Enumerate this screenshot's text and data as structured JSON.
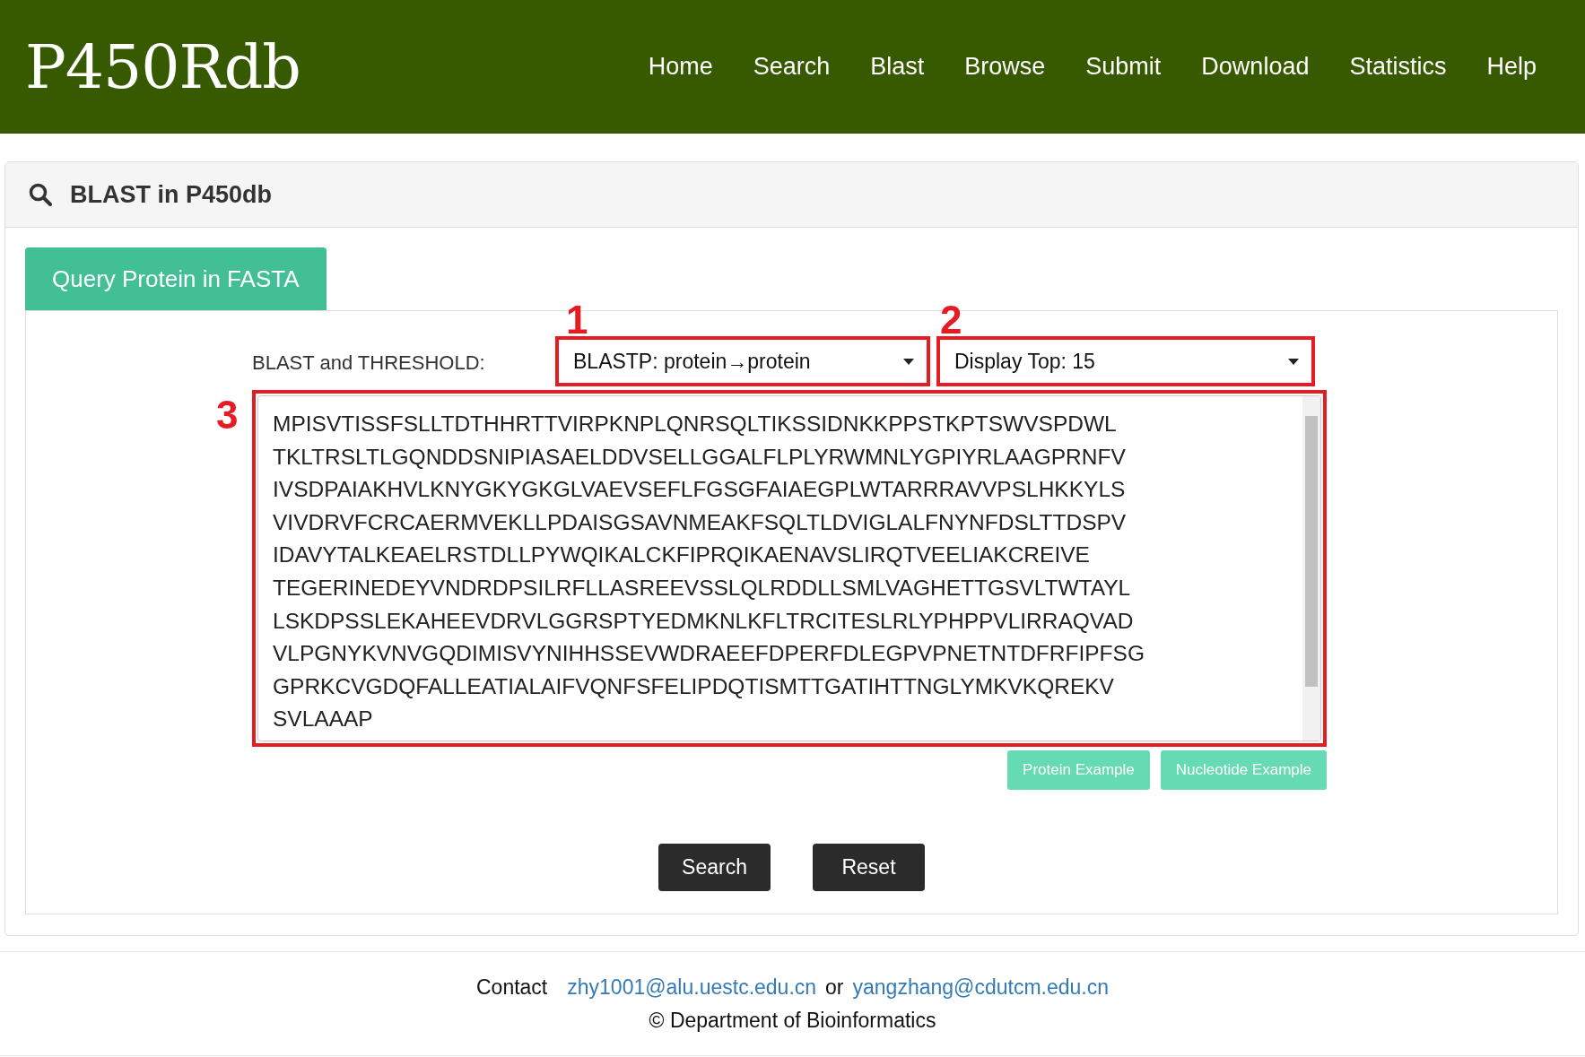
{
  "header": {
    "logo": "P450Rdb",
    "nav": [
      {
        "label": "Home"
      },
      {
        "label": "Search"
      },
      {
        "label": "Blast"
      },
      {
        "label": "Browse"
      },
      {
        "label": "Submit"
      },
      {
        "label": "Download"
      },
      {
        "label": "Statistics"
      },
      {
        "label": "Help"
      }
    ]
  },
  "panel": {
    "title": "BLAST in P450db",
    "tabs": [
      {
        "label": "Query Protein in FASTA",
        "selected": true
      }
    ],
    "form": {
      "label": "BLAST and THRESHOLD:",
      "program_select": {
        "value": "BLASTP:  protein→protein",
        "annotation": "1"
      },
      "display_select": {
        "value": "Display Top:  15",
        "annotation": "2"
      },
      "sequence": {
        "annotation": "3",
        "value": "MPISVTISSFSLLTDTHHRTTVIRPKNPLQNRSQLTIKSSIDNKKPPSTKPTSWVSPDWL\nTKLTRSLTLGQNDDSNIPIASAELDDVSELLGGALFLPLYRWMNLYGPIYRLAAGPRNFV\nIVSDPAIAKHVLKNYGKYGKGLVAEVSEFLFGSGFAIAEGPLWTARRRAVVPSLHKKYLS\nVIVDRVFCRCAERMVEKLLPDAISGSAVNMEAKFSQLTLDVIGLALFNYNFDSLTTDSPV\nIDAVYTALKEAELRSTDLLPYWQIKALCKFIPRQIKAENAVSLIRQTVEELIAKCREIVE\nTEGERINEDEYVNDRDPSILRFLLASREEVSSLQLRDDLLSMLVAGHETTGSVLTWTAYL\nLSKDPSSLEKAHEEVDRVLGGRSPTYEDMKNLKFLTRCITESLRLYPHPPVLIRRAQVAD\nVLPGNYKVNVGQDIMISVYNIHHSSEVWDRAEEFDPERFDLEGPVPNETNTDFRFIPFSG\nGPRKCVGDQFALLEATIALAIFVQNFSFELIPDQTISMTTGATIHTTNGLYMKVKQREKV\nSVLAAAP"
      },
      "example_buttons": [
        "Protein Example",
        "Nucleotide Example"
      ],
      "actions": [
        "Search",
        "Reset"
      ]
    }
  },
  "footer": {
    "contact_label": "Contact",
    "emails": [
      "zhy1001@alu.uestc.edu.cn",
      "yangzhang@cdutcm.edu.cn"
    ],
    "joiner": "or",
    "copyright": "© Department of Bioinformatics"
  }
}
